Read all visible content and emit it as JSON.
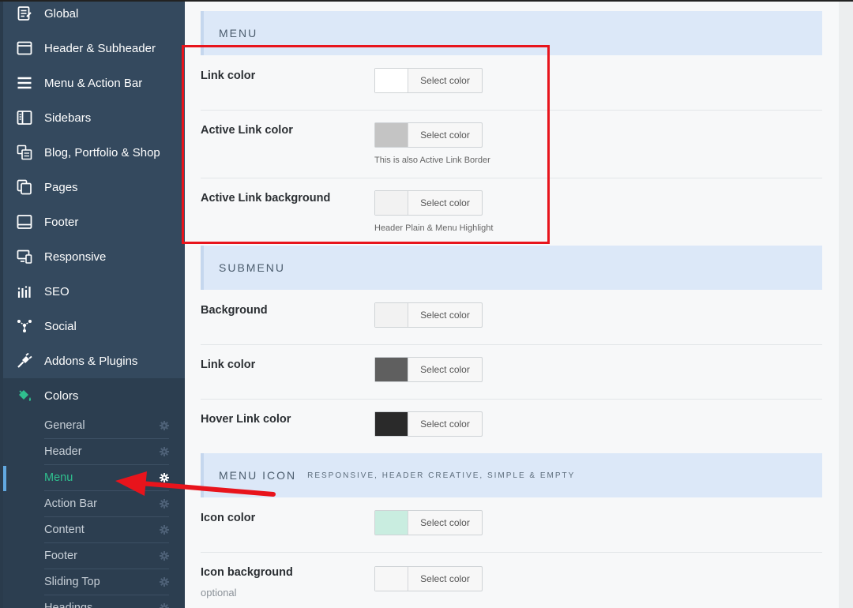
{
  "sidebar": {
    "items": [
      {
        "label": "Global",
        "icon": "global-doc-icon"
      },
      {
        "label": "Header & Subheader",
        "icon": "header-window-icon"
      },
      {
        "label": "Menu & Action Bar",
        "icon": "menu-lines-icon"
      },
      {
        "label": "Sidebars",
        "icon": "sidebar-panel-icon"
      },
      {
        "label": "Blog, Portfolio & Shop",
        "icon": "blog-icon"
      },
      {
        "label": "Pages",
        "icon": "pages-icon"
      },
      {
        "label": "Footer",
        "icon": "footer-icon"
      },
      {
        "label": "Responsive",
        "icon": "responsive-devices-icon"
      },
      {
        "label": "SEO",
        "icon": "seo-bars-icon"
      },
      {
        "label": "Social",
        "icon": "social-icon"
      },
      {
        "label": "Addons & Plugins",
        "icon": "plug-icon"
      },
      {
        "label": "Colors",
        "icon": "paint-bucket-icon"
      }
    ],
    "subitems": [
      {
        "label": "General"
      },
      {
        "label": "Header"
      },
      {
        "label": "Menu"
      },
      {
        "label": "Action Bar"
      },
      {
        "label": "Content"
      },
      {
        "label": "Footer"
      },
      {
        "label": "Sliding Top"
      },
      {
        "label": "Headings"
      }
    ],
    "active_color": "#2fbf8e"
  },
  "sections": {
    "menu": {
      "title": "MENU"
    },
    "submenu": {
      "title": "SUBMENU"
    },
    "menu_icon": {
      "title": "MENU ICON",
      "subtitle": "RESPONSIVE, HEADER CREATIVE, SIMPLE & EMPTY"
    }
  },
  "fields": {
    "menu_link": {
      "label": "Link color",
      "button": "Select color",
      "swatch": "#ffffff"
    },
    "menu_active_link": {
      "label": "Active Link color",
      "button": "Select color",
      "swatch": "#c4c4c4",
      "desc": "This is also Active Link Border"
    },
    "menu_active_bg": {
      "label": "Active Link background",
      "button": "Select color",
      "swatch": "#f2f2f2",
      "desc": "Header Plain & Menu Highlight"
    },
    "sub_bg": {
      "label": "Background",
      "button": "Select color",
      "swatch": "#f2f2f2"
    },
    "sub_link": {
      "label": "Link color",
      "button": "Select color",
      "swatch": "#5f5f5f"
    },
    "sub_hover": {
      "label": "Hover Link color",
      "button": "Select color",
      "swatch": "#2a2a2a"
    },
    "icon_color": {
      "label": "Icon color",
      "button": "Select color",
      "swatch": "#c9ede0"
    },
    "icon_bg": {
      "label": "Icon background",
      "note": "optional",
      "button": "Select color",
      "swatch": "#f7f7f7"
    }
  },
  "annotation": {
    "color": "#e8141c"
  }
}
